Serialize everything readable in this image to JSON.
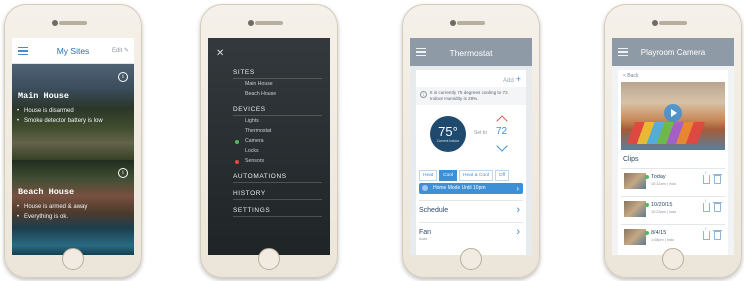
{
  "phone1": {
    "title": "My Sites",
    "edit_label": "Edit",
    "sites": [
      {
        "name": "Main House",
        "lines": [
          "House is disarmed",
          "Smoke detector battery is low"
        ]
      },
      {
        "name": "Beach House",
        "lines": [
          "House is armed & away",
          "Everything is ok."
        ]
      }
    ]
  },
  "phone2": {
    "sections": [
      {
        "label": "SITES",
        "items": [
          {
            "label": "Main House"
          },
          {
            "label": "Beach House"
          }
        ]
      },
      {
        "label": "DEVICES",
        "items": [
          {
            "label": "Lights"
          },
          {
            "label": "Thermostat"
          },
          {
            "label": "Camera",
            "dot": "#4cbb5a"
          },
          {
            "label": "Locks"
          },
          {
            "label": "Sensors",
            "dot": "#e04a3f"
          }
        ]
      },
      {
        "label": "AUTOMATIONS",
        "items": []
      },
      {
        "label": "HISTORY",
        "items": []
      },
      {
        "label": "SETTINGS",
        "items": []
      }
    ]
  },
  "phone3": {
    "title": "Thermostat",
    "add_label": "Add",
    "info_text": "It is currently 75 degrees cooling to 72. Indoor Humidity is 28%.",
    "current_temp": "75°",
    "current_label": "Current Indoor",
    "set_to_label": "Set to",
    "set_value": "72",
    "modes": [
      "Heat",
      "Cool",
      "Heat & Cool",
      "Off"
    ],
    "active_mode": "Cool",
    "home_mode_label": "Home Mode Until 10pm",
    "rows": [
      {
        "label": "Schedule",
        "sub": ""
      },
      {
        "label": "Fan",
        "sub": "Auto"
      }
    ]
  },
  "phone4": {
    "title": "Playroom Camera",
    "back_label": "< Back",
    "clips_label": "Clips",
    "clips": [
      {
        "date": "Today",
        "time": "10:12am | Indo"
      },
      {
        "date": "10/20/15",
        "time": "10:23am | Indo"
      },
      {
        "date": "8/4/15",
        "time": "1:08pm | Indo"
      }
    ]
  }
}
